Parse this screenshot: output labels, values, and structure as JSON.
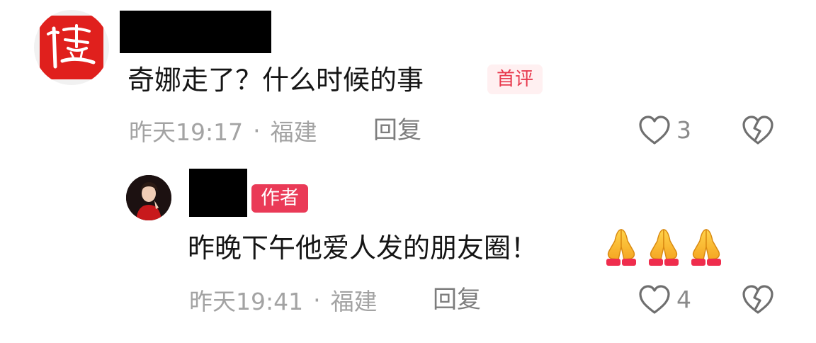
{
  "comment": {
    "avatar": "red-seal-avatar",
    "text": "奇娜走了？什么时候的事",
    "badge": "首评",
    "time": "昨天19:17",
    "separator": "·",
    "location": "福建",
    "reply_label": "回复",
    "like_count": "3"
  },
  "reply": {
    "avatar": "woman-in-red-avatar",
    "author_badge": "作者",
    "text": "昨晚下午他爱人发的朋友圈！",
    "emojis": [
      "folded-hands-emoji",
      "folded-hands-emoji",
      "folded-hands-emoji"
    ],
    "time": "昨天19:41",
    "separator": "·",
    "location": "福建",
    "reply_label": "回复",
    "like_count": "4"
  },
  "colors": {
    "badge_first_bg": "#fff0f1",
    "badge_first_text": "#e83a4e",
    "author_badge_bg": "#ea3a57",
    "meta_text": "#a3a3a3",
    "icon_stroke": "#6f6f6f"
  }
}
